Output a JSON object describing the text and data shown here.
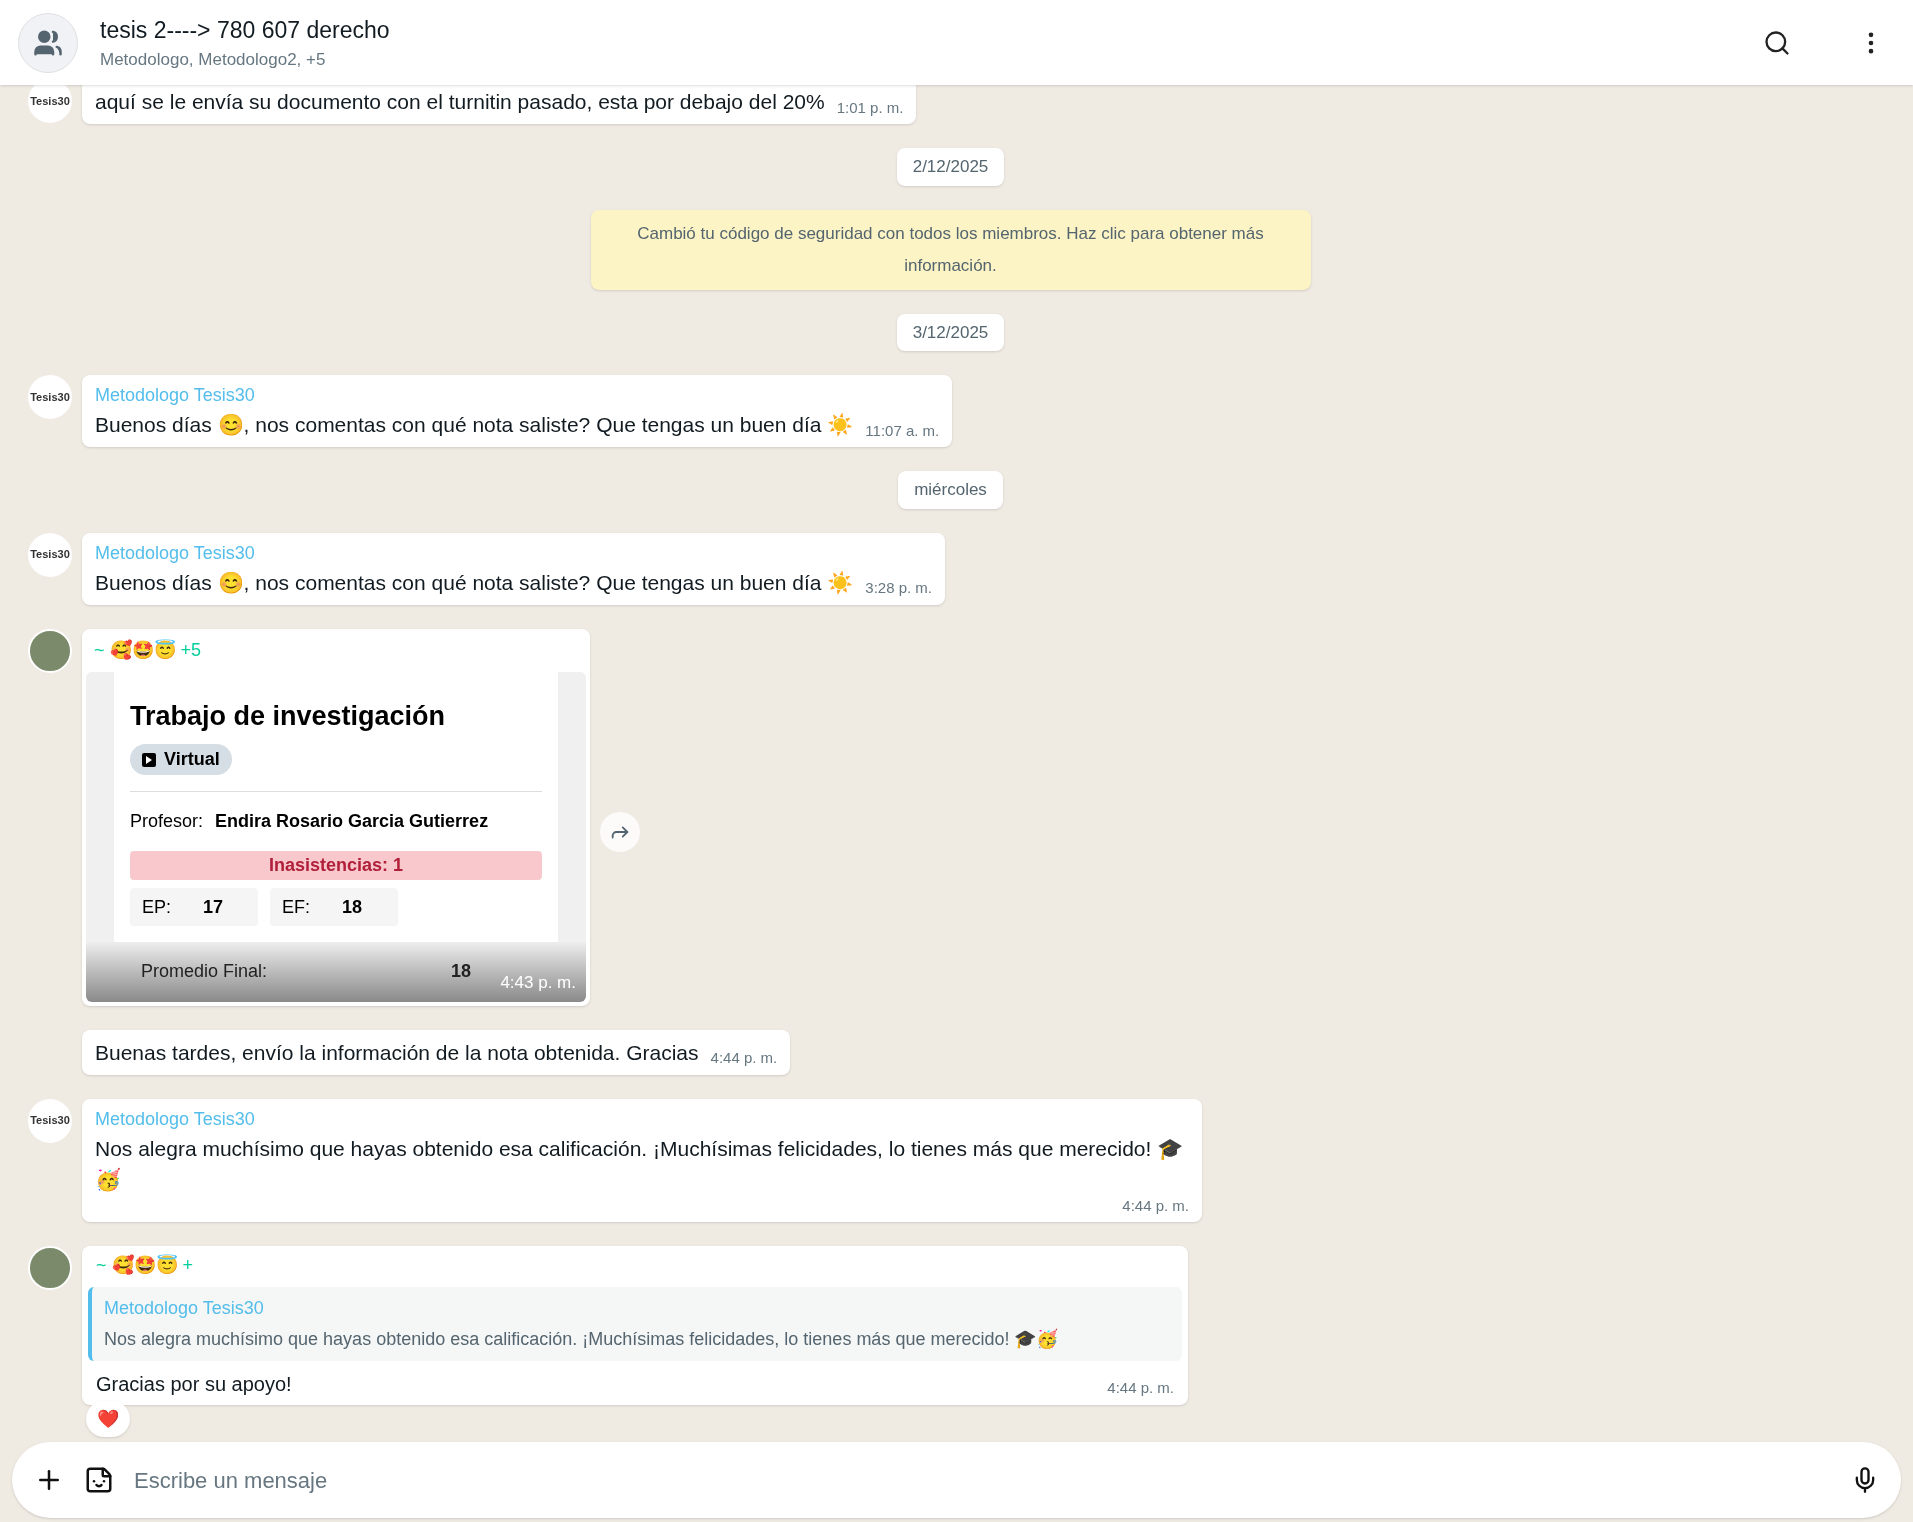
{
  "header": {
    "title": "tesis 2----> 780 607 derecho",
    "subtitle": "Metodologo, Metodologo2, +5"
  },
  "messages": [
    {
      "kind": "text",
      "avatar": {
        "kind": "logo",
        "label": "Tesis30"
      },
      "text": "aquí se le envía su documento con el turnitin pasado, esta por debajo del 20%",
      "time": "1:01 p. m."
    },
    {
      "kind": "date",
      "text": "2/12/2025"
    },
    {
      "kind": "system",
      "text": "Cambió tu código de seguridad con todos los miembros. Haz clic para obtener más información."
    },
    {
      "kind": "date",
      "text": "3/12/2025"
    },
    {
      "kind": "text",
      "avatar": {
        "kind": "logo",
        "label": "Tesis30"
      },
      "sender": "Metodologo Tesis30",
      "text": "Buenos días 😊, nos comentas con qué nota saliste? Que tengas un buen día ☀️",
      "time": "11:07 a. m."
    },
    {
      "kind": "date",
      "text": "miércoles"
    },
    {
      "kind": "text",
      "avatar": {
        "kind": "logo",
        "label": "Tesis30"
      },
      "sender": "Metodologo Tesis30",
      "text": "Buenos días 😊, nos comentas con qué nota saliste? Que tengas un buen día ☀️",
      "time": "3:28 p. m."
    },
    {
      "kind": "card",
      "avatar": {
        "kind": "photo"
      },
      "sender": "~ 🥰🤩😇 +5",
      "time": "4:43 p. m.",
      "card": {
        "title": "Trabajo de investigación",
        "tag": "Virtual",
        "professor_label": "Profesor:",
        "professor": "Endira Rosario Garcia Gutierrez",
        "absences": "Inasistencias: 1",
        "grades": [
          {
            "label": "EP:",
            "value": "17"
          },
          {
            "label": "EF:",
            "value": "18"
          }
        ],
        "final_label": "Promedio Final:",
        "final_value": "18"
      }
    },
    {
      "kind": "text",
      "avatar": {
        "kind": "none"
      },
      "text": "Buenas tardes, envío la información de la nota obtenida. Gracias",
      "time": "4:44 p. m."
    },
    {
      "kind": "text",
      "avatar": {
        "kind": "logo",
        "label": "Tesis30"
      },
      "sender": "Metodologo Tesis30",
      "text": "Nos alegra muchísimo que hayas obtenido esa calificación. ¡Muchísimas felicidades, lo tienes más que merecido! 🎓🥳",
      "time": "4:44 p. m."
    },
    {
      "kind": "quote",
      "avatar": {
        "kind": "photo"
      },
      "sender": "~ 🥰🤩😇 +",
      "quote": {
        "sender": "Metodologo Tesis30",
        "text": "Nos alegra muchísimo que hayas obtenido esa calificación. ¡Muchísimas felicidades, lo tienes más que merecido! 🎓🥳"
      },
      "text": "Gracias por su apoyo!",
      "time": "4:44 p. m.",
      "reaction": "❤️"
    }
  ],
  "composer": {
    "placeholder": "Escribe un mensaje"
  }
}
